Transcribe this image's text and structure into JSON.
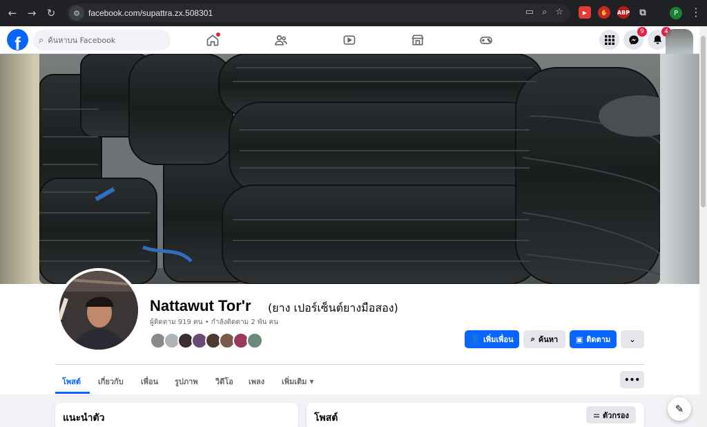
{
  "browser": {
    "url": "facebook.com/supattra.zx.508301",
    "profile_initial": "P",
    "extensions": [
      {
        "name": "youtube-ext-icon",
        "label": "",
        "color": "#e53935"
      },
      {
        "name": "pdf-ext-icon",
        "label": "",
        "color": "#d32f2f"
      },
      {
        "name": "adblock-plus-icon",
        "label": "ABP",
        "color": "#c62828"
      }
    ]
  },
  "fb_header": {
    "logo": "f",
    "search_placeholder": "ค้นหาบน Facebook",
    "messenger_badge": "9",
    "notifications_badge": "4"
  },
  "profile": {
    "name": "Nattawut Tor'r",
    "alternate_name": "(ยาง เปอร์เซ็นต์ยางมือสอง)",
    "stats": "ผู้ติดตาม 919 คน • กำลังติดตาม 2 พัน คน",
    "friend_avatar_colors": [
      "#8a8a8a",
      "#b0b4b8",
      "#3a2e2e",
      "#6b4a7a",
      "#4d3b2d",
      "#7a5a4a",
      "#9a3a5a",
      "#6a8a7a"
    ]
  },
  "actions": {
    "add_friend": "เพิ่มเพื่อน",
    "search": "ค้นหา",
    "follow": "ติดตาม"
  },
  "tabs": [
    "โพสต์",
    "เกี่ยวกับ",
    "เพื่อน",
    "รูปภาพ",
    "วิดีโอ",
    "เพลง",
    "เพิ่มเติม"
  ],
  "intro_card": {
    "title": "แนะนำตัว"
  },
  "posts_card": {
    "title": "โพสต์",
    "filter_label": "ตัวกรอง"
  },
  "colors": {
    "accent": "#0866ff",
    "badge": "#e41e3f"
  }
}
